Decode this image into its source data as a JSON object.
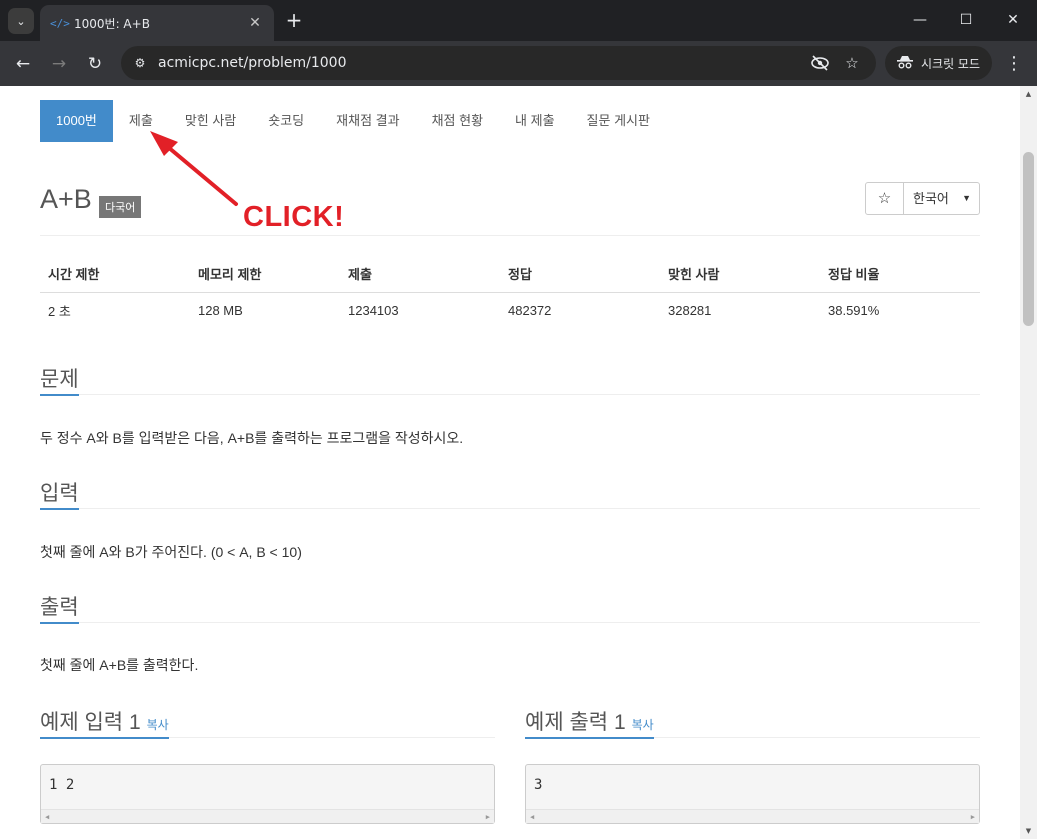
{
  "browser": {
    "tab_title": "1000번: A+B",
    "tab_favicon": "</>",
    "url": "acmicpc.net/problem/1000",
    "incognito_label": "시크릿 모드"
  },
  "problem_nav": {
    "items": [
      {
        "label": "1000번",
        "active": true
      },
      {
        "label": "제출",
        "active": false
      },
      {
        "label": "맞힌 사람",
        "active": false
      },
      {
        "label": "숏코딩",
        "active": false
      },
      {
        "label": "재채점 결과",
        "active": false
      },
      {
        "label": "채점 현황",
        "active": false
      },
      {
        "label": "내 제출",
        "active": false
      },
      {
        "label": "질문 게시판",
        "active": false
      }
    ]
  },
  "annotation": {
    "text": "CLICK!",
    "color": "#e22027"
  },
  "problem": {
    "title": "A+B",
    "badge": "다국어",
    "language_select": "한국어"
  },
  "info_table": {
    "headers": [
      "시간 제한",
      "메모리 제한",
      "제출",
      "정답",
      "맞힌 사람",
      "정답 비율"
    ],
    "values": [
      "2 초",
      "128 MB",
      "1234103",
      "482372",
      "328281",
      "38.591%"
    ]
  },
  "sections": {
    "problem_heading": "문제",
    "problem_text": "두 정수 A와 B를 입력받은 다음, A+B를 출력하는 프로그램을 작성하시오.",
    "input_heading": "입력",
    "input_text": "첫째 줄에 A와 B가 주어진다. (0 < A, B < 10)",
    "output_heading": "출력",
    "output_text": "첫째 줄에 A+B를 출력한다."
  },
  "samples": {
    "input_heading": "예제 입력 1",
    "output_heading": "예제 출력 1",
    "copy_label": "복사",
    "input_value": "1 2",
    "output_value": "3"
  },
  "colors": {
    "accent": "#428bca",
    "annotation": "#e22027"
  }
}
